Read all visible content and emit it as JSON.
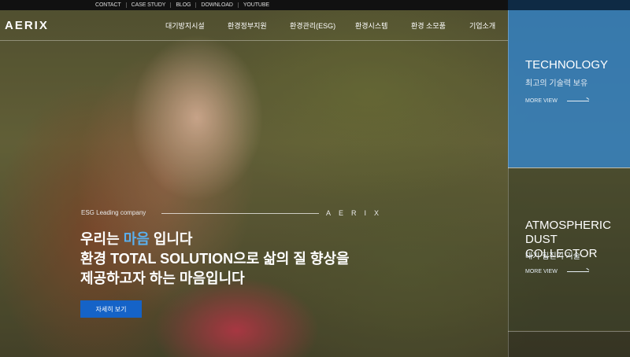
{
  "util_links": [
    "CONTACT",
    "CASE STUDY",
    "BLOG",
    "DOWNLOAD",
    "YOUTUBE"
  ],
  "logo": "AERIX",
  "gnb": [
    "대기방지시설",
    "환경정부지원",
    "환경관리(ESG)",
    "환경시스템",
    "환경 소모품",
    "기업소개"
  ],
  "panels": [
    {
      "title": "TECHNOLOGY",
      "sub": "최고의 기술력 보유",
      "more": "MORE VIEW"
    },
    {
      "title": "ATMOSPHERIC DUST COLLECTOR",
      "title_line1": "ATMOSPHERIC",
      "title_line2": "DUST COLLECTOR",
      "sub": "대기 집진기 기술",
      "more": "MORE VIEW"
    }
  ],
  "hero": {
    "esg_label": "ESG Leading company",
    "brand": "AERIX",
    "line1_a": "우리는 ",
    "line1_hl": "마음",
    "line1_b": " 입니다",
    "line2": "환경 TOTAL SOLUTION으로 삶의 질 향상을",
    "line3": "제공하고자 하는 마음입니다",
    "button": "자세히 보기"
  },
  "colors": {
    "accent": "#1563c7",
    "highlight": "#5ab0ef",
    "panel_blue": "#3282c8"
  }
}
